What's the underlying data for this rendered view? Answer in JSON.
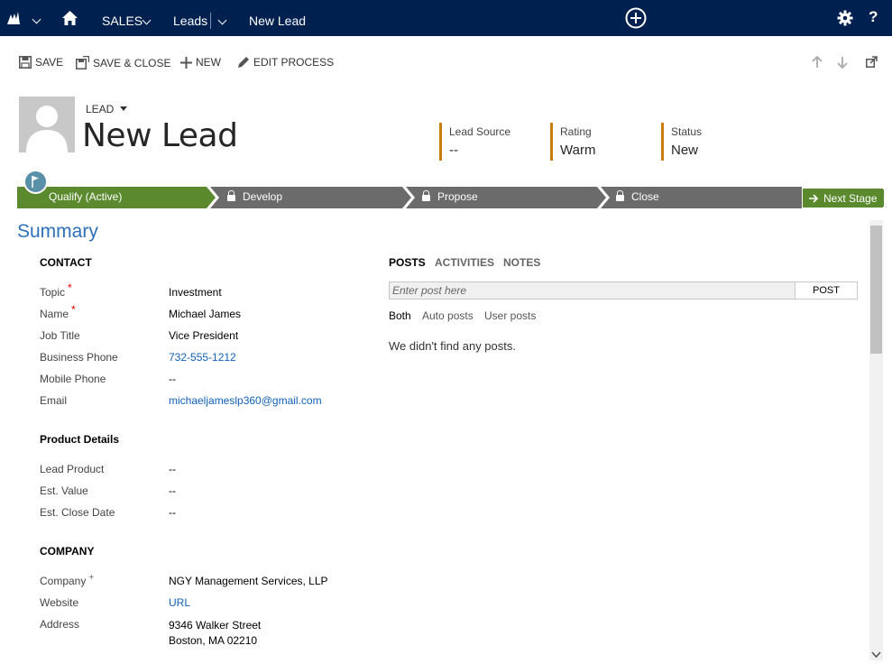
{
  "nav": {
    "app_label": "SALES",
    "area_label": "Leads",
    "record_label": "New Lead"
  },
  "commands": {
    "save": "SAVE",
    "save_close": "SAVE & CLOSE",
    "new": "NEW",
    "edit_process": "EDIT PROCESS"
  },
  "header": {
    "entity": "LEAD",
    "title": "New Lead",
    "fields": [
      {
        "label": "Lead Source",
        "value": "--"
      },
      {
        "label": "Rating",
        "value": "Warm"
      },
      {
        "label": "Status",
        "value": "New"
      }
    ]
  },
  "process": {
    "stages": [
      "Qualify (Active)",
      "Develop",
      "Propose",
      "Close"
    ],
    "next_stage": "Next Stage",
    "colors": {
      "active": "#5b8a2e",
      "inactive": "#6b6b6b",
      "next_text": "#5b8a2e"
    }
  },
  "summary": {
    "title": "Summary",
    "contact": {
      "heading": "CONTACT",
      "fields": [
        {
          "label": "Topic",
          "value": "Investment",
          "required": true
        },
        {
          "label": "Name",
          "value": "Michael James",
          "required": true
        },
        {
          "label": "Job Title",
          "value": "Vice President"
        },
        {
          "label": "Business Phone",
          "value": "732-555-1212"
        },
        {
          "label": "Mobile Phone",
          "value": "--"
        },
        {
          "label": "Email",
          "value": "michaeljameslp360@gmail.com"
        }
      ]
    },
    "product": {
      "heading": "Product Details",
      "fields": [
        {
          "label": "Lead Product",
          "value": "--"
        },
        {
          "label": "Est. Value",
          "value": "--"
        },
        {
          "label": "Est. Close Date",
          "value": "--"
        }
      ]
    },
    "company": {
      "heading": "COMPANY",
      "fields": [
        {
          "label": "Company",
          "value": "NGY Management Services, LLP",
          "recommended": true
        },
        {
          "label": "Website",
          "value": "URL"
        },
        {
          "label": "Address",
          "value_line1": "9346 Walker Street",
          "value_line2": "Boston, MA 02210"
        }
      ]
    },
    "required_mark": "*",
    "recommended_mark": "+"
  },
  "posts": {
    "tabs": [
      "POSTS",
      "ACTIVITIES",
      "NOTES"
    ],
    "placeholder": "Enter post here",
    "post_button": "POST",
    "filters": [
      "Both",
      "Auto posts",
      "User posts"
    ],
    "empty_message": "We didn't find any posts."
  },
  "colors": {
    "nav_bg": "#002050",
    "accent_link": "#1160b7",
    "summary_title": "#2e70b8",
    "header_field_bar": "#c87d0e"
  }
}
